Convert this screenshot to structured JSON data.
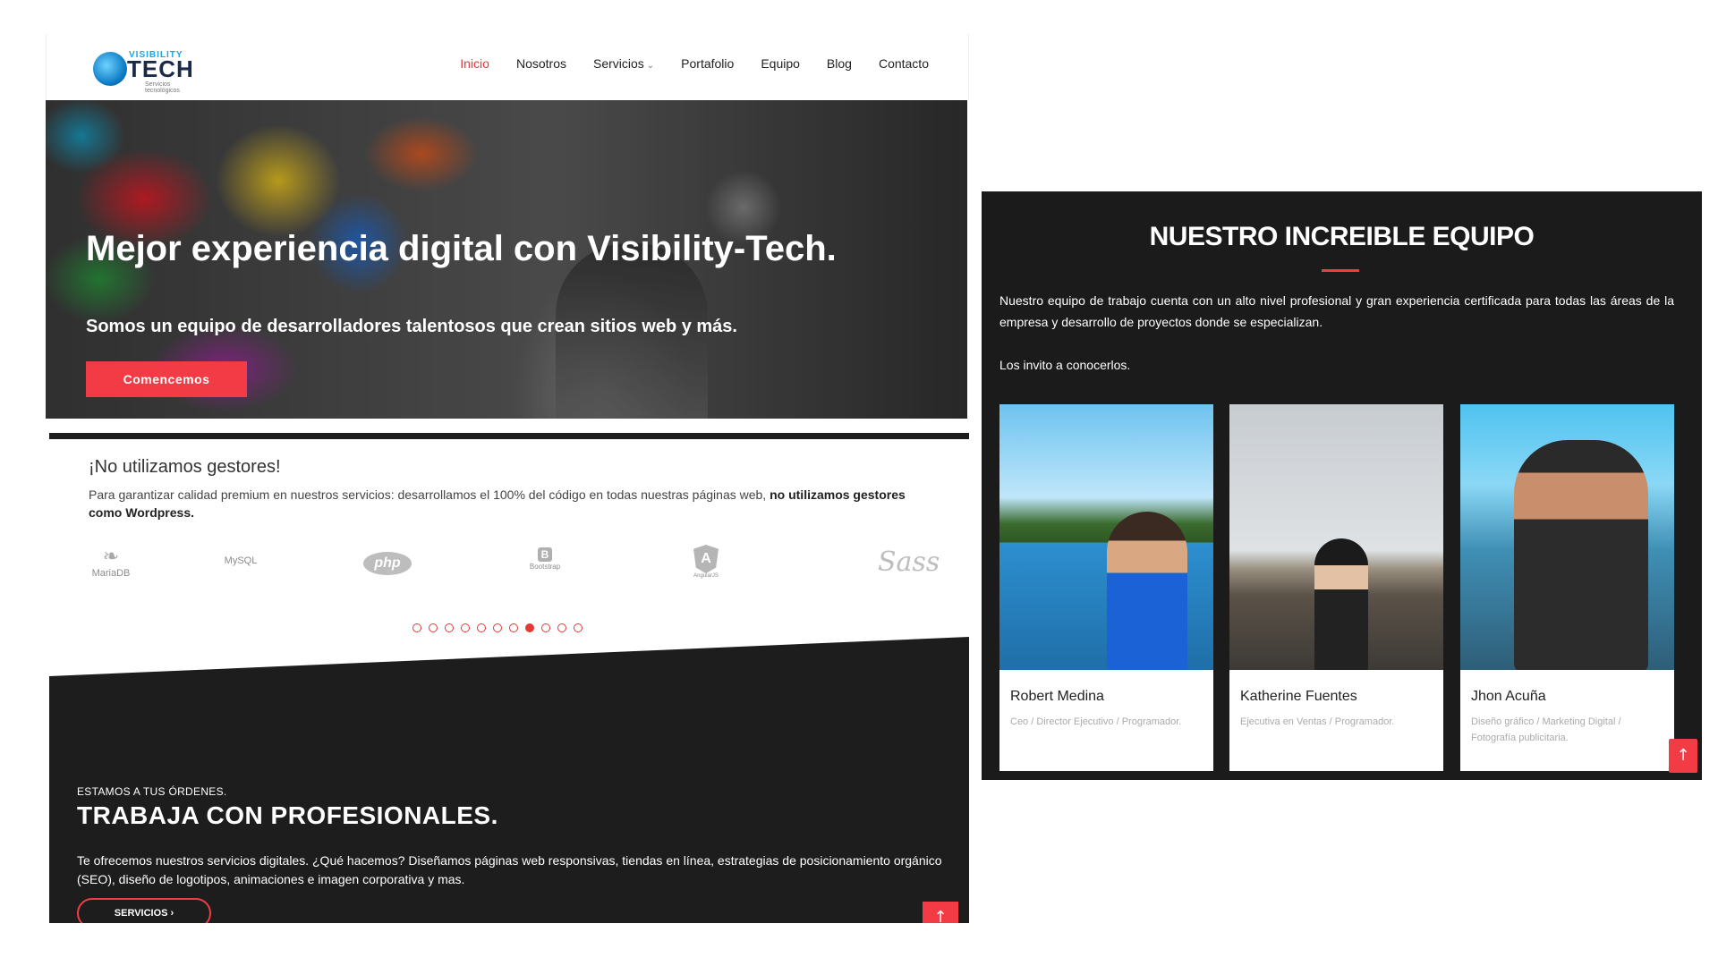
{
  "nav": {
    "logo_top": "VISIBILITY",
    "logo_main": "TECH",
    "logo_sub": "Servicios tecnológicos",
    "items": [
      {
        "label": "Inicio",
        "active": true
      },
      {
        "label": "Nosotros"
      },
      {
        "label": "Servicios",
        "dropdown": true
      },
      {
        "label": "Portafolio"
      },
      {
        "label": "Equipo"
      },
      {
        "label": "Blog"
      },
      {
        "label": "Contacto"
      }
    ]
  },
  "hero": {
    "title": "Mejor experiencia digital con Visibility-Tech.",
    "subtitle": "Somos un equipo de desarrolladores talentosos que crean sitios web y más.",
    "button": "Comencemos"
  },
  "nocms": {
    "title": "¡No utilizamos gestores!",
    "text": "Para garantizar calidad premium en nuestros servicios: desarrollamos el 100% del código en todas nuestras páginas web, ",
    "text_bold": "no utilizamos gestores como Wordpress.",
    "logos": [
      "MariaDB",
      "MySQL",
      "php",
      "Bootstrap",
      "AngularJS",
      "Sass"
    ],
    "dots_total": 11,
    "dots_active_index": 7
  },
  "pro": {
    "eyebrow": "ESTAMOS A TUS ÓRDENES.",
    "title": "TRABAJA CON PROFESIONALES.",
    "text": "Te ofrecemos nuestros servicios digitales. ¿Qué hacemos? Diseñamos páginas web responsivas, tiendas en línea, estrategias de posicionamiento orgánico (SEO), diseño de logotipos, animaciones e imagen corporativa y mas.",
    "button": "SERVICIOS  ›",
    "up_icon": "↑"
  },
  "team": {
    "title": "NUESTRO INCREIBLE EQUIPO",
    "desc": "Nuestro equipo de trabajo cuenta con un alto nivel profesional y gran experiencia certificada para todas las áreas de la empresa y desarrollo de proyectos donde se especializan.",
    "invite": "Los invito a conocerlos.",
    "members": [
      {
        "name": "Robert Medina",
        "role": "Ceo / Director Ejecutivo / Programador."
      },
      {
        "name": "Katherine Fuentes",
        "role": "Ejecutiva en Ventas / Programador."
      },
      {
        "name": "Jhon Acuña",
        "role": "Diseño gráfico / Marketing Digital / Fotografía publicitaria."
      }
    ],
    "up_icon": "↑"
  },
  "colors": {
    "accent": "#f23b45",
    "dark": "#1d1d1d"
  }
}
